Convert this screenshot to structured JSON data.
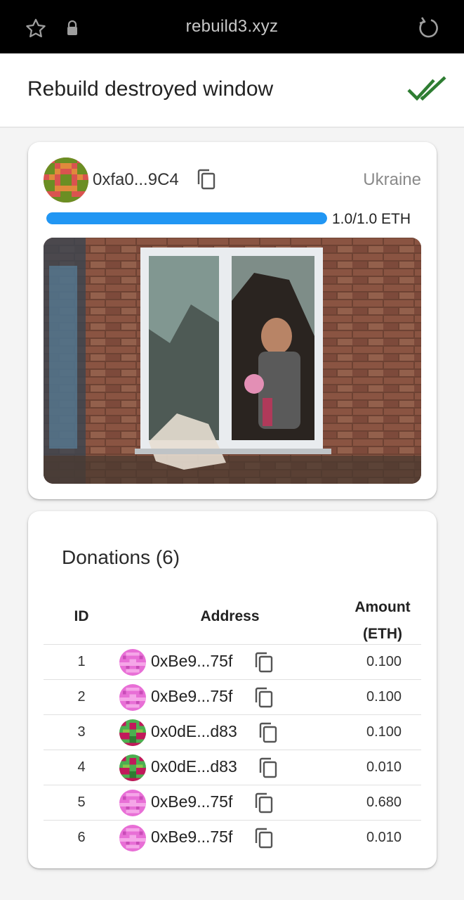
{
  "browser": {
    "url": "rebuild3.xyz",
    "icons": [
      "star-icon",
      "lock-icon",
      "reload-icon"
    ]
  },
  "header": {
    "title": "Rebuild destroyed window",
    "status_icon": "double-check-icon",
    "status_color": "#2e7d32"
  },
  "project": {
    "owner_address": "0xfa0...9C4",
    "country": "Ukraine",
    "progress_label": "1.0/1.0 ETH",
    "progress_fraction": 1.0,
    "accent_color": "#2196f3"
  },
  "donations": {
    "title": "Donations (6)",
    "columns": {
      "id": "ID",
      "address": "Address",
      "amount_line1": "Amount",
      "amount_line2": "(ETH)"
    },
    "rows": [
      {
        "id": "1",
        "address": "0xBe9...75f",
        "amount": "0.100",
        "avatar": "pink"
      },
      {
        "id": "2",
        "address": "0xBe9...75f",
        "amount": "0.100",
        "avatar": "pink"
      },
      {
        "id": "3",
        "address": "0x0dE...d83",
        "amount": "0.100",
        "avatar": "green"
      },
      {
        "id": "4",
        "address": "0x0dE...d83",
        "amount": "0.010",
        "avatar": "green"
      },
      {
        "id": "5",
        "address": "0xBe9...75f",
        "amount": "0.680",
        "avatar": "pink"
      },
      {
        "id": "6",
        "address": "0xBe9...75f",
        "amount": "0.010",
        "avatar": "pink"
      }
    ]
  }
}
